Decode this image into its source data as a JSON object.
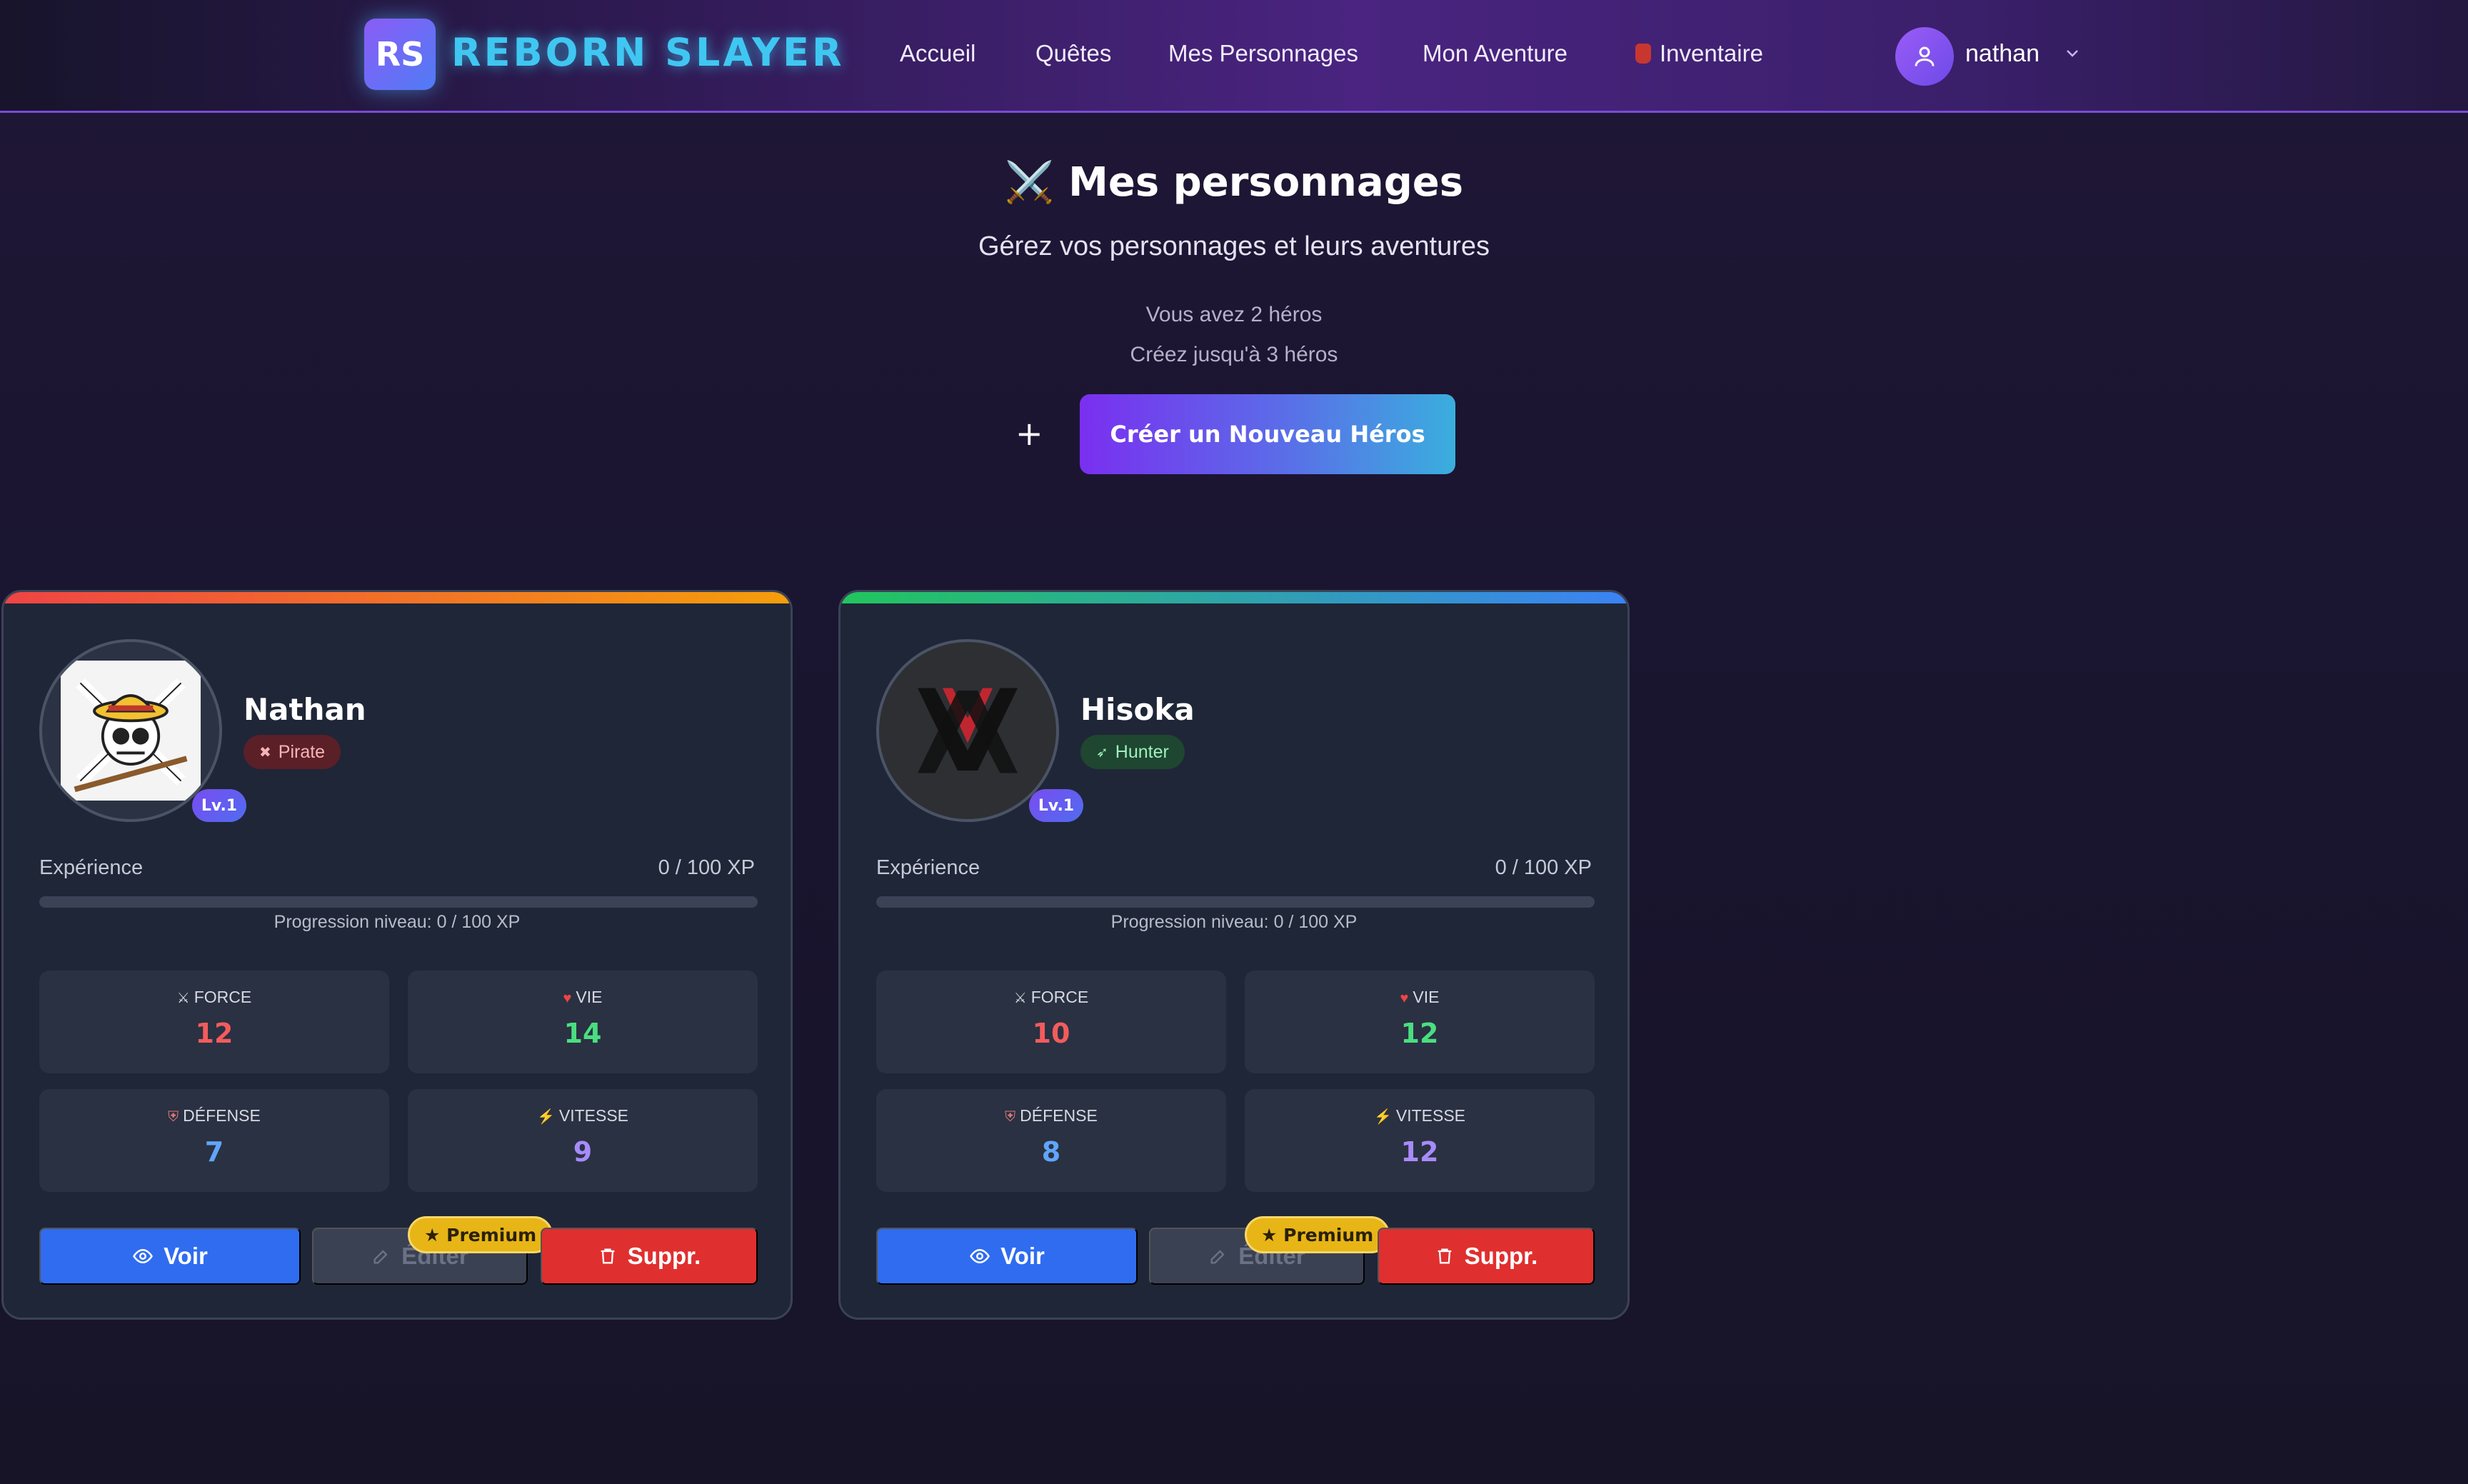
{
  "nav": {
    "logo_initials": "RS",
    "logo_text": "REBORN SLAYER",
    "links": [
      "Accueil",
      "Quêtes",
      "Mes Personnages",
      "Mon Aventure",
      "Inventaire"
    ],
    "inventory_icon": "backpack-icon",
    "user": "nathan"
  },
  "header": {
    "title_icon": "⚔️",
    "title": "Mes personnages",
    "subtitle": "Gérez vos personnages et leurs aventures",
    "hero_count": "Vous avez 2 héros",
    "hero_limit": "Créez jusqu'à 3 héros",
    "plus": "+",
    "create_button": "Créer un Nouveau Héros"
  },
  "labels": {
    "experience": "Expérience",
    "view": "Voir",
    "edit": "Éditer",
    "delete": "Suppr.",
    "premium": "★ Premium"
  },
  "characters": [
    {
      "name": "Nathan",
      "class": "Pirate",
      "class_icon": "skull-icon",
      "level": "Lv.1",
      "xp": "0 / 100 XP",
      "xp_fraction": 0,
      "progress": "Progression niveau: 0 / 100 XP",
      "stats": {
        "force": {
          "label": "FORCE",
          "value": "12"
        },
        "vie": {
          "label": "VIE",
          "value": "14"
        },
        "defense": {
          "label": "DÉFENSE",
          "value": "7"
        },
        "vitesse": {
          "label": "VITESSE",
          "value": "9"
        }
      }
    },
    {
      "name": "Hisoka",
      "class": "Hunter",
      "class_icon": "bow-icon",
      "level": "Lv.1",
      "xp": "0 / 100 XP",
      "xp_fraction": 0,
      "progress": "Progression niveau: 0 / 100 XP",
      "stats": {
        "force": {
          "label": "FORCE",
          "value": "10"
        },
        "vie": {
          "label": "VIE",
          "value": "12"
        },
        "defense": {
          "label": "DÉFENSE",
          "value": "8"
        },
        "vitesse": {
          "label": "VITESSE",
          "value": "12"
        }
      }
    }
  ],
  "colors": {
    "accent_purple": "#7a2ff0",
    "accent_cyan": "#3aaede",
    "force": "#f25c5c",
    "vie": "#4ade80",
    "defense": "#60a5fa",
    "vitesse": "#a78bfa",
    "premium": "#e8b517"
  }
}
